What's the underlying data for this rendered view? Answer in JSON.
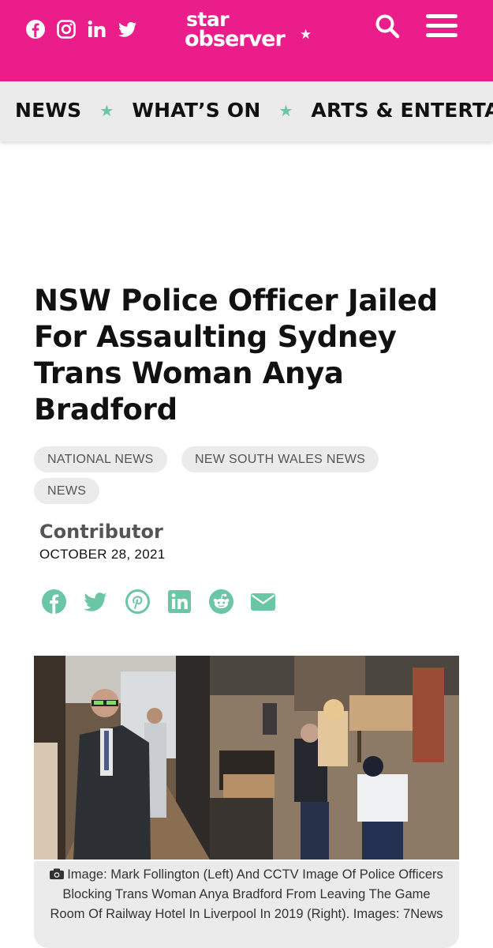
{
  "header": {
    "logo_line1": "star",
    "logo_line2": "observer",
    "logo_star": "★",
    "social_icons": [
      "facebook-icon",
      "instagram-icon",
      "linkedin-icon",
      "twitter-icon"
    ],
    "brand_color": "#ea1d8b"
  },
  "nav": {
    "items": [
      "NEWS",
      "WHAT’S ON",
      "ARTS & ENTERTAINMENT"
    ],
    "separator": "★",
    "separator_color": "#6bc6a5"
  },
  "article": {
    "title": "NSW Police Officer Jailed For Assaulting Sydney Trans Woman Anya Bradford",
    "tags": [
      "NATIONAL NEWS",
      "NEW SOUTH WALES NEWS",
      "NEWS"
    ],
    "author": "Contributor",
    "date": "OCTOBER 28, 2021",
    "share_icons": [
      "facebook-icon",
      "twitter-icon",
      "pinterest-icon",
      "linkedin-icon",
      "reddit-icon",
      "email-icon"
    ],
    "share_color": "#6bc6a5",
    "caption": "Image: Mark Follington (Left) And CCTV Image Of Police Officers Blocking Trans Woman Anya Bradford From Leaving The Game Room Of Railway Hotel In Liverpool In 2019 (Right). Images: 7News"
  }
}
